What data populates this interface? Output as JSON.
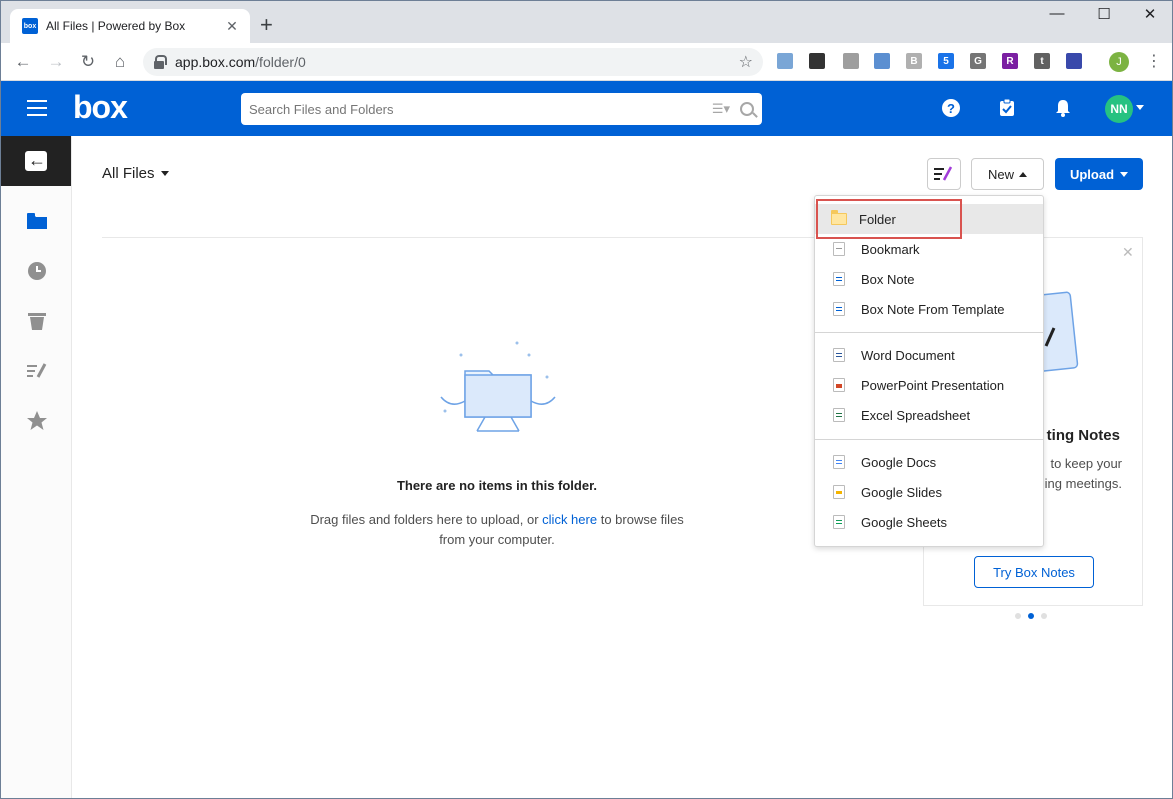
{
  "browser": {
    "tab_title": "All Files | Powered by Box",
    "favicon_text": "box",
    "url_host": "app.box.com",
    "url_path": "/folder/0",
    "profile_initial": "J",
    "window_controls": [
      "—",
      "☐",
      "✕"
    ],
    "extensions": [
      {
        "name": "extension-doc-icon",
        "label": "",
        "color": "#7aa6d6"
      },
      {
        "name": "extension-circle-icon",
        "label": "",
        "color": "#333333"
      },
      {
        "name": "extension-gray-icon",
        "label": "",
        "color": "#9e9e9e"
      },
      {
        "name": "extension-camera-icon",
        "label": "",
        "color": "#5b8fd1"
      },
      {
        "name": "extension-b-icon",
        "label": "B",
        "color": "#b0b0b0"
      },
      {
        "name": "extension-badge-icon",
        "label": "5",
        "color": "#1a73e8"
      },
      {
        "name": "extension-g-icon",
        "label": "G",
        "color": "#757575"
      },
      {
        "name": "extension-r-icon",
        "label": "R",
        "color": "#7b1fa2"
      },
      {
        "name": "extension-t-icon",
        "label": "t",
        "color": "#616161"
      },
      {
        "name": "extension-grid-icon",
        "label": "",
        "color": "#3949ab"
      }
    ]
  },
  "header": {
    "logo": "box",
    "search_placeholder": "Search Files and Folders",
    "avatar_initials": "NN",
    "help_label": "?"
  },
  "main": {
    "breadcrumb": "All Files",
    "new_button": "New",
    "upload_button": "Upload",
    "empty_title": "There are no items in this folder.",
    "empty_text_before": "Drag files and folders here to upload, or ",
    "empty_link": "click here",
    "empty_text_after": " to browse files from your computer."
  },
  "promo": {
    "title": "ting Notes",
    "body_line1": "to keep your",
    "body_line2": "ing meetings.",
    "button": "Try Box Notes"
  },
  "new_menu": {
    "items": [
      {
        "label": "Folder",
        "icon": "folder-icon"
      },
      {
        "label": "Bookmark",
        "icon": "bookmark-icon"
      },
      {
        "label": "Box Note",
        "icon": "box-note-icon"
      },
      {
        "label": "Box Note From Template",
        "icon": "box-note-template-icon"
      },
      {
        "label": "Word Document",
        "icon": "word-icon"
      },
      {
        "label": "PowerPoint Presentation",
        "icon": "powerpoint-icon"
      },
      {
        "label": "Excel Spreadsheet",
        "icon": "excel-icon"
      },
      {
        "label": "Google Docs",
        "icon": "google-docs-icon"
      },
      {
        "label": "Google Slides",
        "icon": "google-slides-icon"
      },
      {
        "label": "Google Sheets",
        "icon": "google-sheets-icon"
      }
    ]
  },
  "colors": {
    "brand": "#0061d5",
    "highlight": "#d9534f"
  }
}
